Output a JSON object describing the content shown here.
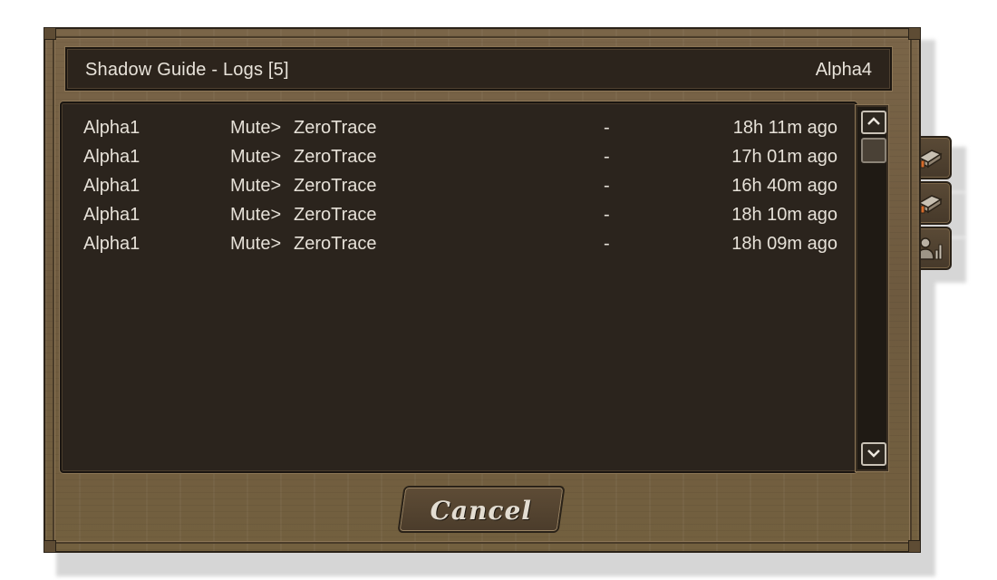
{
  "window": {
    "title": "Shadow Guide - Logs [5]",
    "user": "Alpha4"
  },
  "logs": [
    {
      "name": "Alpha1",
      "action": "Mute>",
      "target": "ZeroTrace",
      "sep": "-",
      "time": "18h 11m ago"
    },
    {
      "name": "Alpha1",
      "action": "Mute>",
      "target": "ZeroTrace",
      "sep": "-",
      "time": "17h 01m ago"
    },
    {
      "name": "Alpha1",
      "action": "Mute>",
      "target": "ZeroTrace",
      "sep": "-",
      "time": "16h 40m ago"
    },
    {
      "name": "Alpha1",
      "action": "Mute>",
      "target": "ZeroTrace",
      "sep": "-",
      "time": "18h 10m ago"
    },
    {
      "name": "Alpha1",
      "action": "Mute>",
      "target": "ZeroTrace",
      "sep": "-",
      "time": "18h 09m ago"
    }
  ],
  "buttons": {
    "cancel": "Cancel"
  },
  "side_tabs": [
    {
      "icon": "book-icon"
    },
    {
      "icon": "book-icon"
    },
    {
      "icon": "player-stats-icon"
    }
  ],
  "colors": {
    "wood": "#6e5a3f",
    "panel": "#2b241d",
    "text": "#e6e1d8"
  }
}
